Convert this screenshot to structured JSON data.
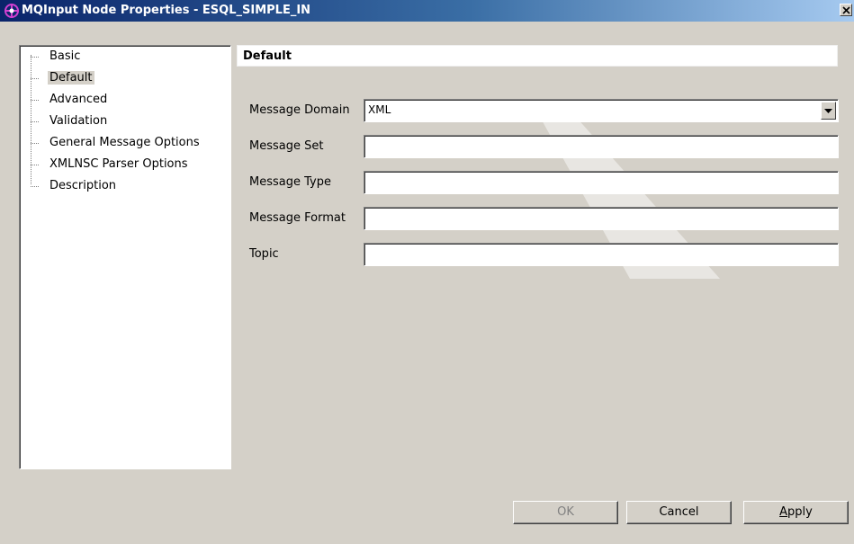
{
  "window": {
    "title": "MQInput Node Properties - ESQL_SIMPLE_IN",
    "icon": "node-properties-icon",
    "close_icon": "close-icon"
  },
  "tree": {
    "items": [
      {
        "label": "Basic",
        "selected": false
      },
      {
        "label": "Default",
        "selected": true
      },
      {
        "label": "Advanced",
        "selected": false
      },
      {
        "label": "Validation",
        "selected": false
      },
      {
        "label": "General Message Options",
        "selected": false
      },
      {
        "label": "XMLNSC Parser Options",
        "selected": false
      },
      {
        "label": "Description",
        "selected": false
      }
    ]
  },
  "panel": {
    "header": "Default",
    "fields": [
      {
        "label": "Message Domain",
        "type": "select",
        "value": "XML"
      },
      {
        "label": "Message Set",
        "type": "text",
        "value": ""
      },
      {
        "label": "Message Type",
        "type": "text",
        "value": ""
      },
      {
        "label": "Message Format",
        "type": "text",
        "value": ""
      },
      {
        "label": "Topic",
        "type": "text",
        "value": ""
      }
    ]
  },
  "buttons": {
    "ok": {
      "label": "OK",
      "enabled": false
    },
    "cancel": {
      "label": "Cancel",
      "enabled": true
    },
    "apply": {
      "label": "Apply",
      "enabled": true,
      "mnemonic": "A"
    }
  },
  "colors": {
    "title_start": "#0a246a",
    "title_end": "#a6caf0",
    "dialog_bg": "#d4d0c8",
    "icon_accent": "#b030b0"
  }
}
